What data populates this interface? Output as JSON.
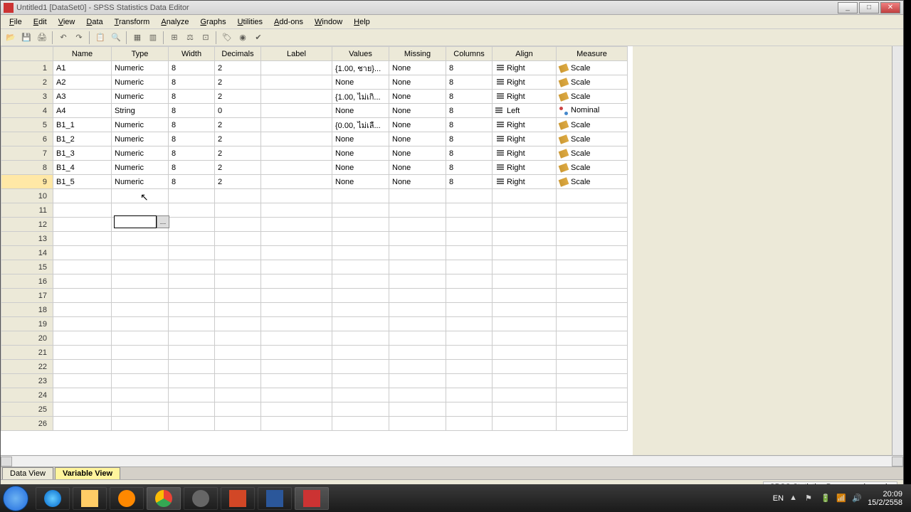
{
  "window": {
    "title": "Untitled1 [DataSet0] - SPSS Statistics Data Editor"
  },
  "menu": [
    "File",
    "Edit",
    "View",
    "Data",
    "Transform",
    "Analyze",
    "Graphs",
    "Utilities",
    "Add-ons",
    "Window",
    "Help"
  ],
  "columns": [
    "Name",
    "Type",
    "Width",
    "Decimals",
    "Label",
    "Values",
    "Missing",
    "Columns",
    "Align",
    "Measure"
  ],
  "rows": [
    {
      "n": "1",
      "name": "A1",
      "type": "Numeric",
      "width": "8",
      "decimals": "2",
      "label": "",
      "values": "{1.00, ชาย}...",
      "missing": "None",
      "cols": "8",
      "align": "Right",
      "measure": "Scale"
    },
    {
      "n": "2",
      "name": "A2",
      "type": "Numeric",
      "width": "8",
      "decimals": "2",
      "label": "",
      "values": "None",
      "missing": "None",
      "cols": "8",
      "align": "Right",
      "measure": "Scale"
    },
    {
      "n": "3",
      "name": "A3",
      "type": "Numeric",
      "width": "8",
      "decimals": "2",
      "label": "",
      "values": "{1.00, ไม่เกิ...",
      "missing": "None",
      "cols": "8",
      "align": "Right",
      "measure": "Scale"
    },
    {
      "n": "4",
      "name": "A4",
      "type": "String",
      "width": "8",
      "decimals": "0",
      "label": "",
      "values": "None",
      "missing": "None",
      "cols": "8",
      "align": "Left",
      "measure": "Nominal"
    },
    {
      "n": "5",
      "name": "B1_1",
      "type": "Numeric",
      "width": "8",
      "decimals": "2",
      "label": "",
      "values": "{0.00, ไม่เลื...",
      "missing": "None",
      "cols": "8",
      "align": "Right",
      "measure": "Scale"
    },
    {
      "n": "6",
      "name": "B1_2",
      "type": "Numeric",
      "width": "8",
      "decimals": "2",
      "label": "",
      "values": "None",
      "missing": "None",
      "cols": "8",
      "align": "Right",
      "measure": "Scale"
    },
    {
      "n": "7",
      "name": "B1_3",
      "type": "Numeric",
      "width": "8",
      "decimals": "2",
      "label": "",
      "values": "None",
      "missing": "None",
      "cols": "8",
      "align": "Right",
      "measure": "Scale"
    },
    {
      "n": "8",
      "name": "B1_4",
      "type": "Numeric",
      "width": "8",
      "decimals": "2",
      "label": "",
      "values": "None",
      "missing": "None",
      "cols": "8",
      "align": "Right",
      "measure": "Scale"
    },
    {
      "n": "9",
      "name": "B1_5",
      "type": "Numeric",
      "width": "8",
      "decimals": "2",
      "label": "",
      "values": "None",
      "missing": "None",
      "cols": "8",
      "align": "Right",
      "measure": "Scale"
    }
  ],
  "empty_rows": [
    "10",
    "11",
    "12",
    "13",
    "14",
    "15",
    "16",
    "17",
    "18",
    "19",
    "20",
    "21",
    "22",
    "23",
    "24",
    "25",
    "26"
  ],
  "tabs": {
    "data_view": "Data View",
    "variable_view": "Variable View"
  },
  "status": "SPSS Statistics Processor is ready",
  "tray": {
    "lang": "EN",
    "time": "20:09",
    "date": "15/2/2558"
  }
}
